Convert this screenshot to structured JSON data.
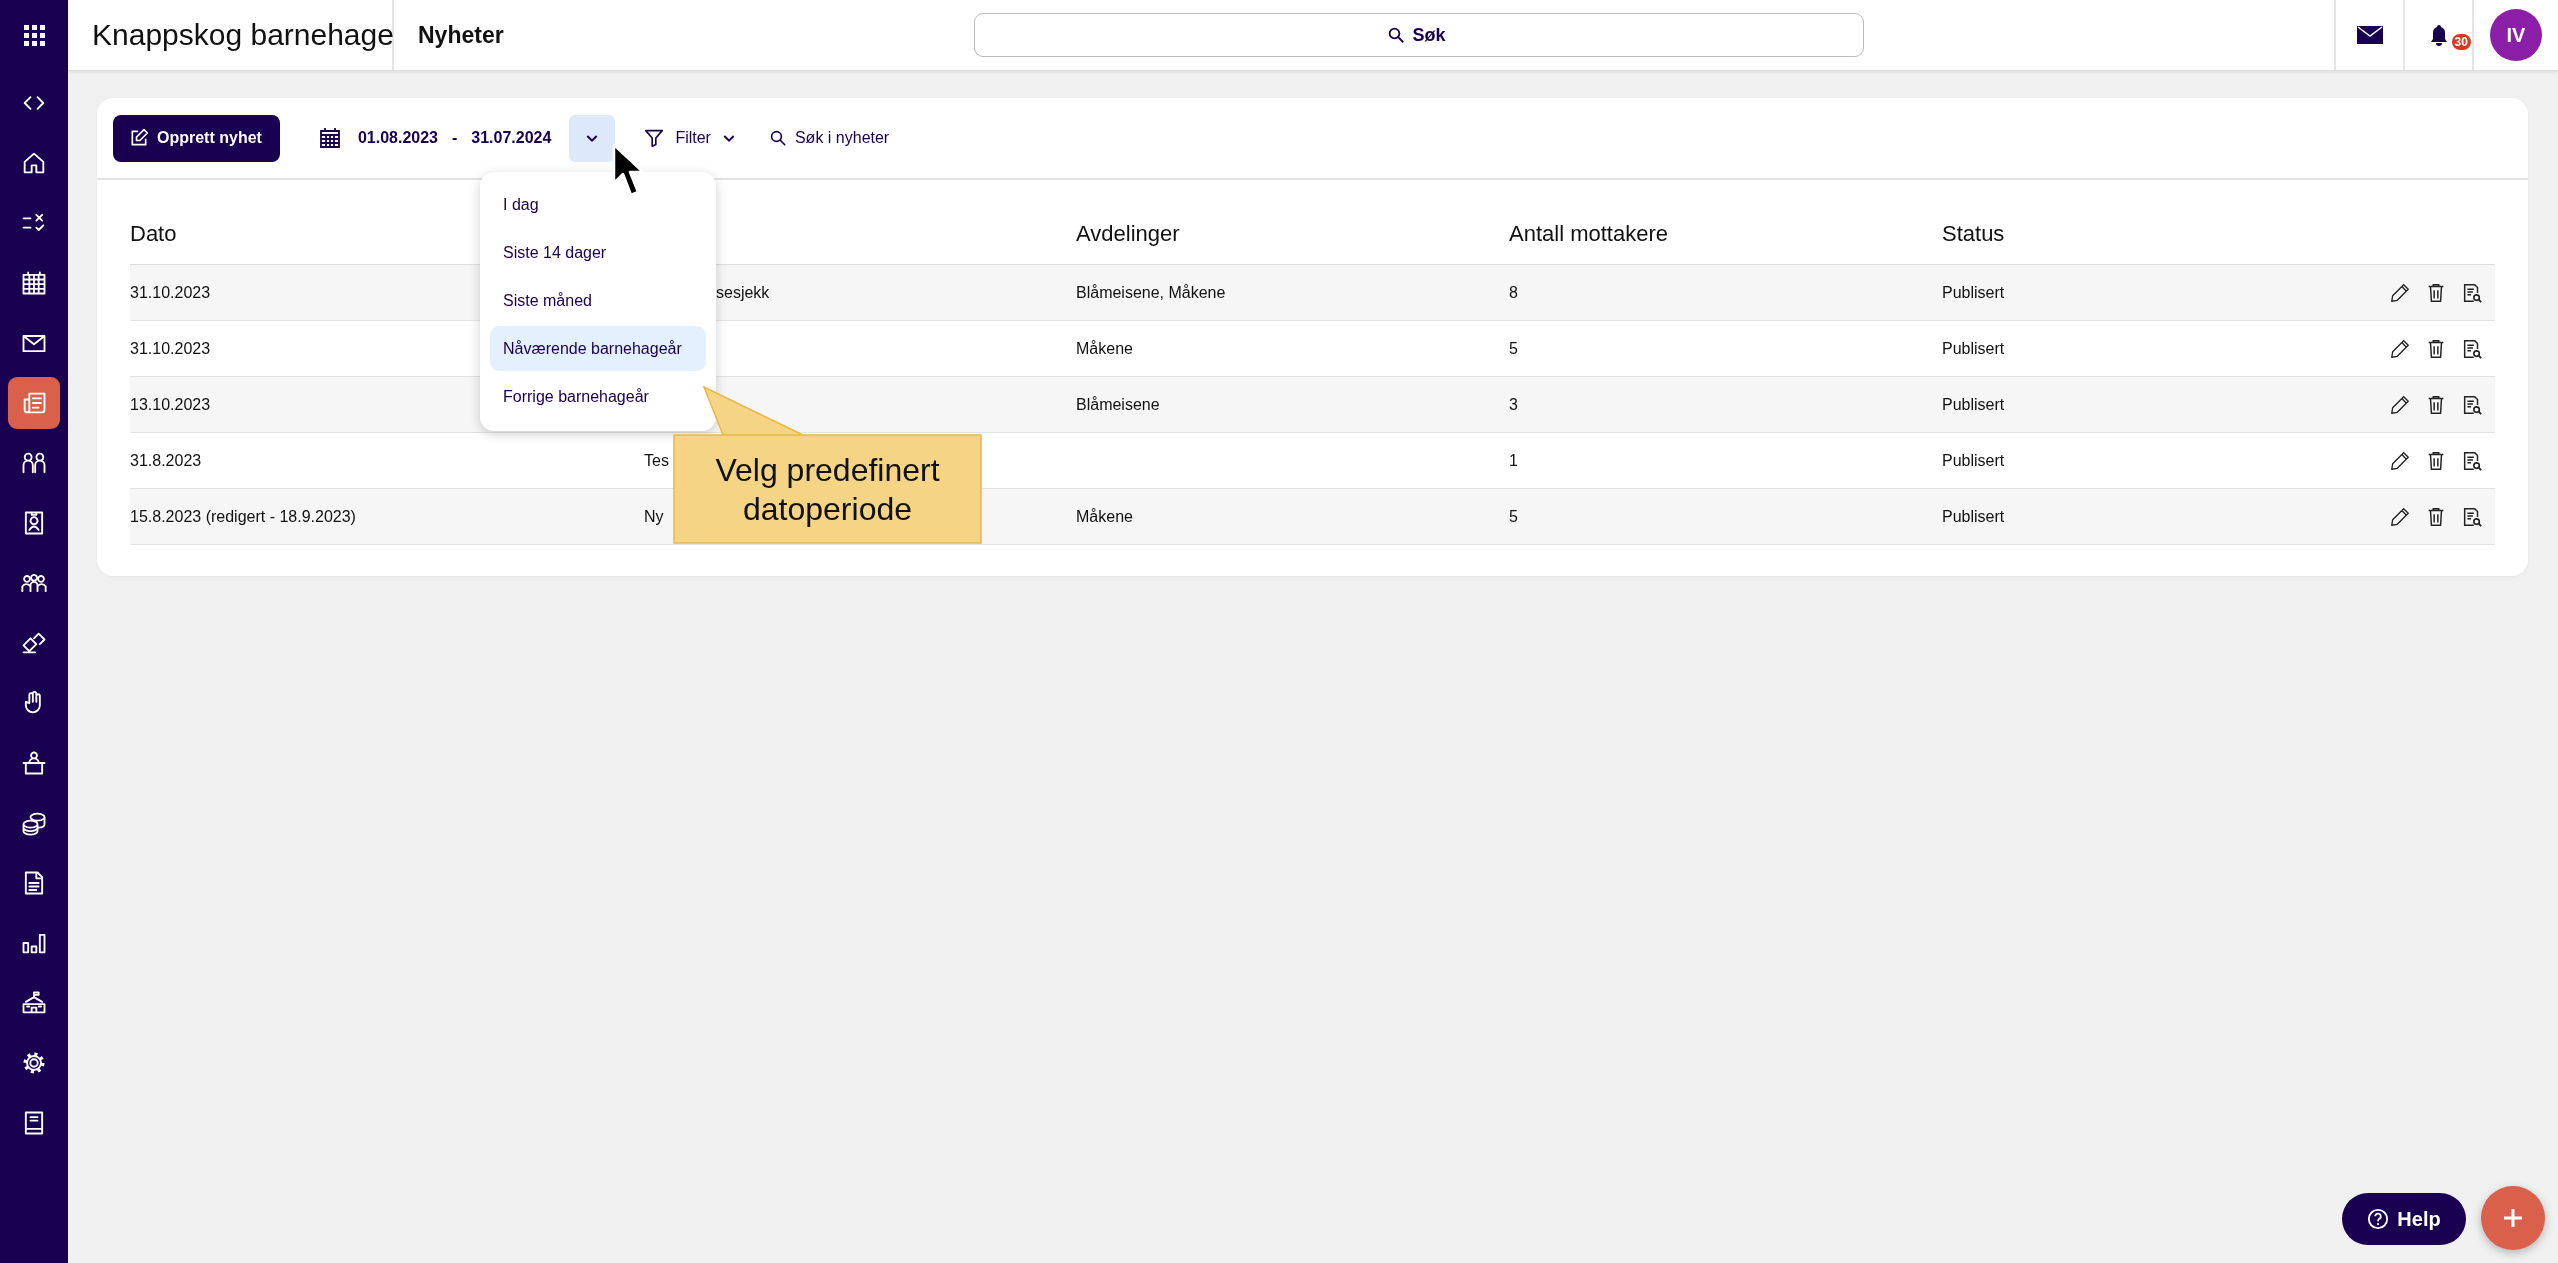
{
  "sidebar": {
    "items": [
      {
        "selected": false
      },
      {
        "selected": false
      },
      {
        "selected": false
      },
      {
        "selected": false
      },
      {
        "selected": false
      },
      {
        "selected": true
      },
      {
        "selected": false
      },
      {
        "selected": false
      },
      {
        "selected": false
      },
      {
        "selected": false
      },
      {
        "selected": false
      },
      {
        "selected": false
      },
      {
        "selected": false
      },
      {
        "selected": false
      },
      {
        "selected": false
      },
      {
        "selected": false
      },
      {
        "selected": false
      },
      {
        "selected": false
      }
    ]
  },
  "topbar": {
    "app_title": "Knappskog barnehage",
    "page_title": "Nyheter",
    "search": {
      "placeholder": "Søk"
    },
    "notifications": {
      "count": "30"
    },
    "avatar": {
      "initials": "IV"
    }
  },
  "toolbar": {
    "create_button": "Opprett nyhet",
    "date_from": "01.08.2023",
    "date_separator": "-",
    "date_to": "31.07.2024",
    "date_menu_open": true,
    "filter_button": "Filter",
    "search_link": "Søk i nyheter"
  },
  "date_menu": {
    "items": [
      {
        "label": "I dag",
        "selected": false
      },
      {
        "label": "Siste 14 dager",
        "selected": false
      },
      {
        "label": "Siste måned",
        "selected": false
      },
      {
        "label": "Nåværende barnehageår",
        "selected": true
      },
      {
        "label": "Forrige barnehageår",
        "selected": false
      }
    ]
  },
  "callout": {
    "text": "Velg predefinert datoperiode"
  },
  "table": {
    "columns": {
      "date": "Dato",
      "departments": "Avdelinger",
      "recipients": "Antall mottakere",
      "status": "Status"
    },
    "rows": [
      {
        "date": "31.10.2023",
        "column_2": "sesjekk",
        "departments": "Blåmeisene, Måkene",
        "recipients": "8",
        "status": "Publisert"
      },
      {
        "date": "31.10.2023",
        "departments": "Måkene",
        "recipients": "5",
        "status": "Publisert"
      },
      {
        "date": "13.10.2023",
        "departments": "Blåmeisene",
        "recipients": "3",
        "status": "Publisert"
      },
      {
        "date": "31.8.2023",
        "column_2": "Tes",
        "recipients": "1",
        "status": "Publisert"
      },
      {
        "date": "15.8.2023 (redigert - 18.9.2023)",
        "column_2": "Ny",
        "departments": "Måkene",
        "recipients": "5",
        "status": "Publisert"
      }
    ]
  },
  "help_button": {
    "label": "Help"
  }
}
